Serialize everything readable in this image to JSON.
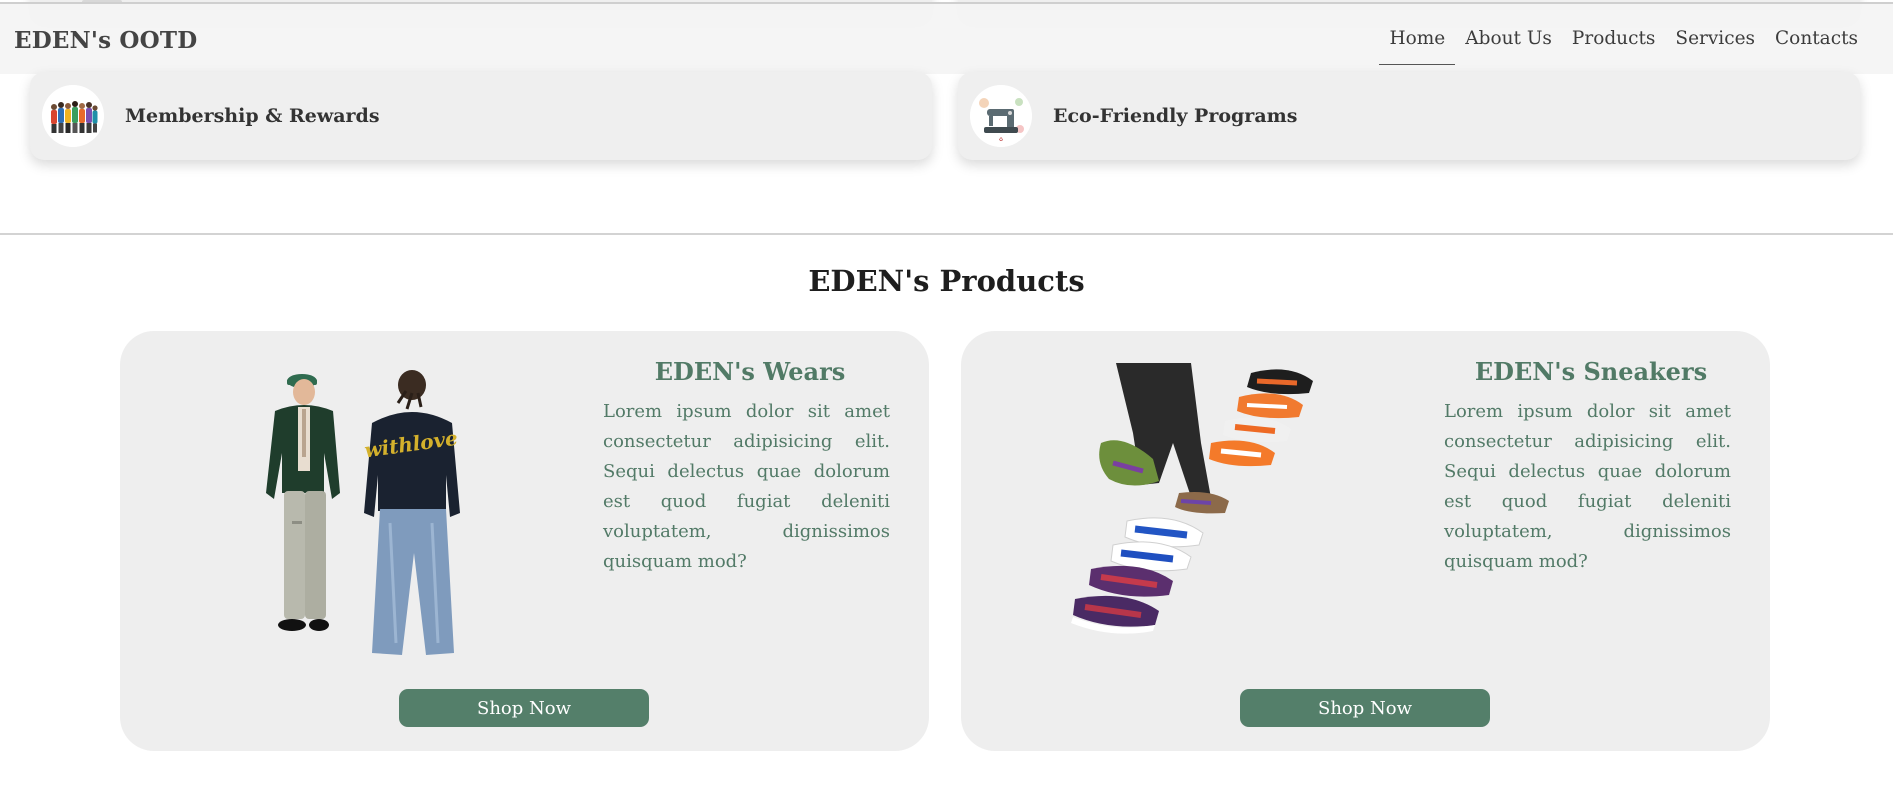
{
  "header": {
    "brand": "EDEN's OOTD",
    "nav": [
      {
        "label": "Home",
        "active": true
      },
      {
        "label": "About Us"
      },
      {
        "label": "Products"
      },
      {
        "label": "Services"
      },
      {
        "label": "Contacts"
      }
    ]
  },
  "services": [
    {
      "label": "Membership & Rewards",
      "icon": "people-group-icon"
    },
    {
      "label": "Eco-Friendly Programs",
      "icon": "sewing-machine-icon"
    }
  ],
  "products_section": {
    "title": "EDEN's Products",
    "items": [
      {
        "title": "EDEN's Wears",
        "description": "Lorem ipsum dolor sit amet consectetur adipisicing elit. Sequi delectus quae dolorum est quod fugiat deleniti voluptatem, dignissimos quisquam mod?",
        "button": "Shop Now",
        "image": "outfit-models-image",
        "print_text": "withlove"
      },
      {
        "title": "EDEN's Sneakers",
        "description": "Lorem ipsum dolor sit amet consectetur adipisicing elit. Sequi delectus quae dolorum est quod fugiat deleniti voluptatem, dignissimos quisquam mod?",
        "button": "Shop Now",
        "image": "sneakers-image"
      }
    ]
  },
  "colors": {
    "accent": "#547f6a",
    "accent_text": "#517a66",
    "card_bg": "#eeeeee"
  }
}
